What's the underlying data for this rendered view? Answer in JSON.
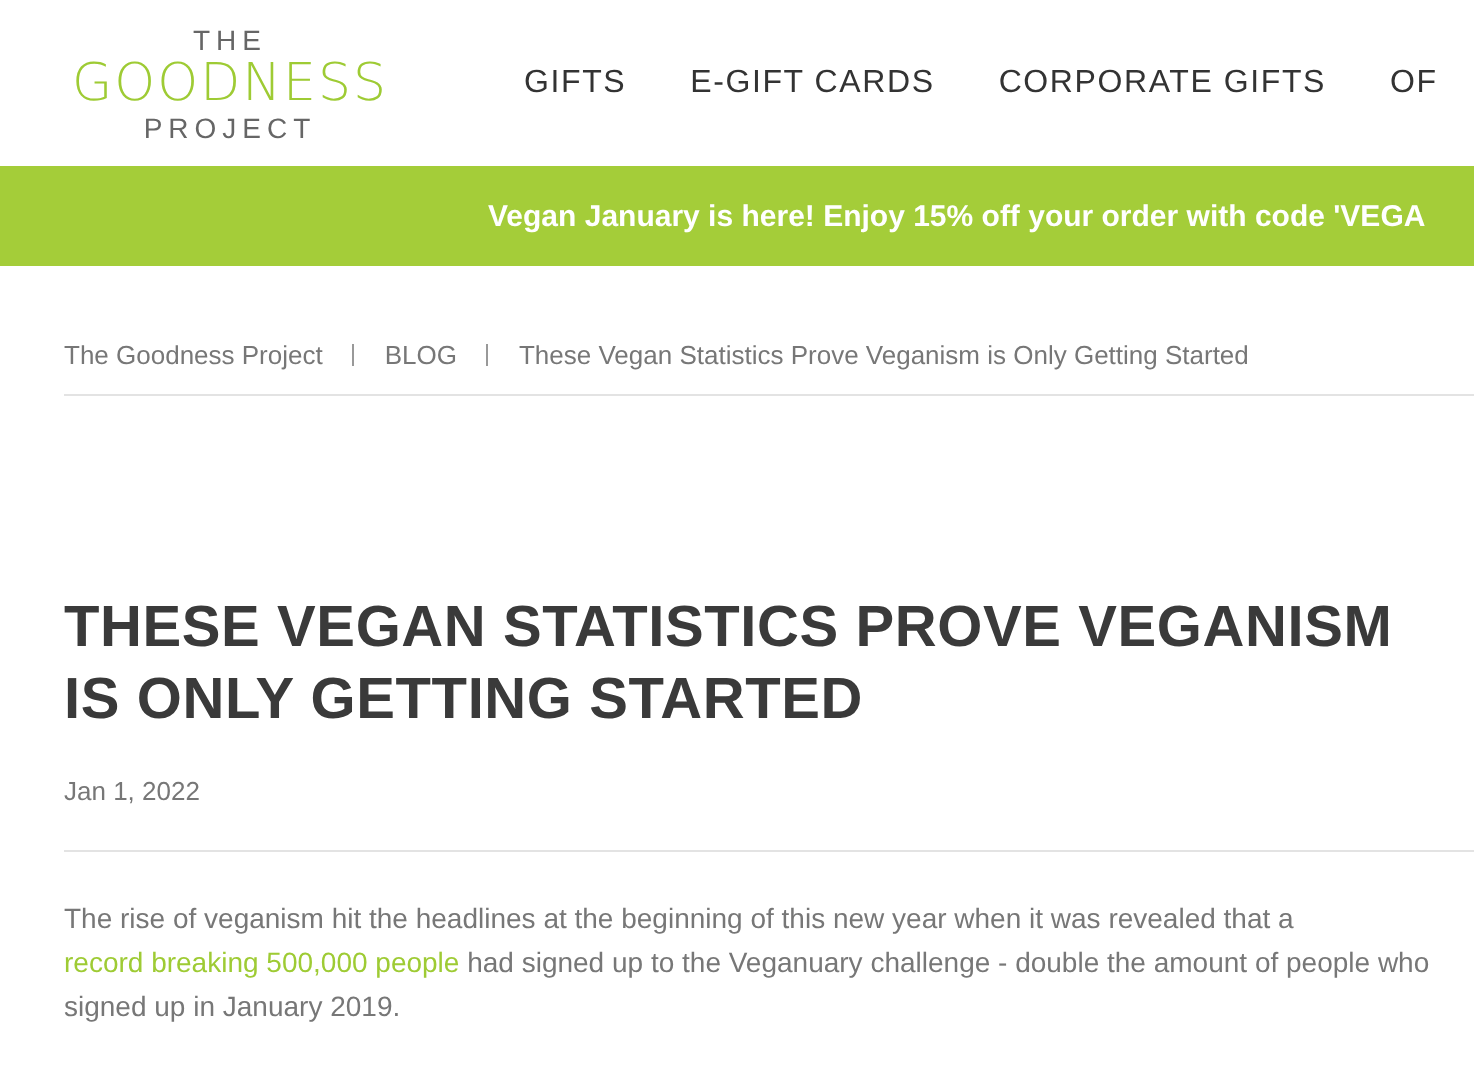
{
  "logo": {
    "top": "THE",
    "main": "GOODNESS",
    "bottom": "PROJECT"
  },
  "nav": [
    "GIFTS",
    "E-GIFT CARDS",
    "CORPORATE GIFTS",
    "OF"
  ],
  "banner": {
    "text": "Vegan January is here! Enjoy 15% off your order with code 'VEGA"
  },
  "breadcrumbs": [
    "The Goodness Project",
    "BLOG",
    "These Vegan Statistics Prove Veganism is Only Getting Started"
  ],
  "article": {
    "title": "THESE VEGAN STATISTICS PROVE VEGANISM IS ONLY GETTING STARTED",
    "date": "Jan 1, 2022",
    "intro": {
      "text_before": "The rise of veganism hit the headlines at the beginning of this new year when it was revealed that a ",
      "link": "record breaking 500,000 people",
      "text_after": " had signed up to the Veganuary challenge - double the amount of people who signed up in January 2019."
    }
  }
}
